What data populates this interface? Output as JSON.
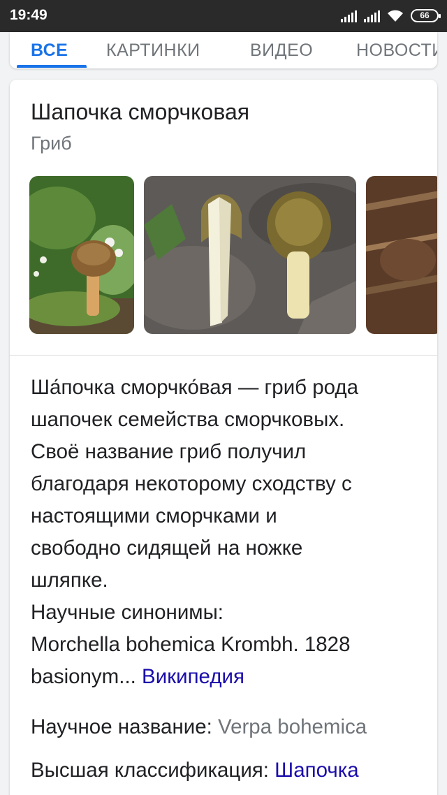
{
  "status_bar": {
    "time": "19:49",
    "battery": "66"
  },
  "tabs": [
    {
      "label": "ВСЕ",
      "active": true
    },
    {
      "label": "КАРТИНКИ",
      "active": false
    },
    {
      "label": "ВИДЕО",
      "active": false
    },
    {
      "label": "НОВОСТИ",
      "active": false
    }
  ],
  "knowledge_panel": {
    "title": "Шапочка сморчковая",
    "subtitle": "Гриб",
    "description_lines": [
      "Ша́почка сморчко́вая — гриб рода",
      "шапочек семейства сморчковых.",
      "Своё название гриб получил",
      "благодаря некоторому сходству с",
      "настоящими сморчками и",
      "свободно сидящей на ножке",
      "шляпке.",
      "Научные синонимы:",
      "Morchella bohemica Krombh. 1828",
      "basionym..."
    ],
    "source_link": "Википедия",
    "facts": [
      {
        "label": "Научное название:",
        "value": "Verpa bohemica"
      },
      {
        "label": "Высшая классификация:",
        "value": "Шапочка"
      }
    ]
  }
}
